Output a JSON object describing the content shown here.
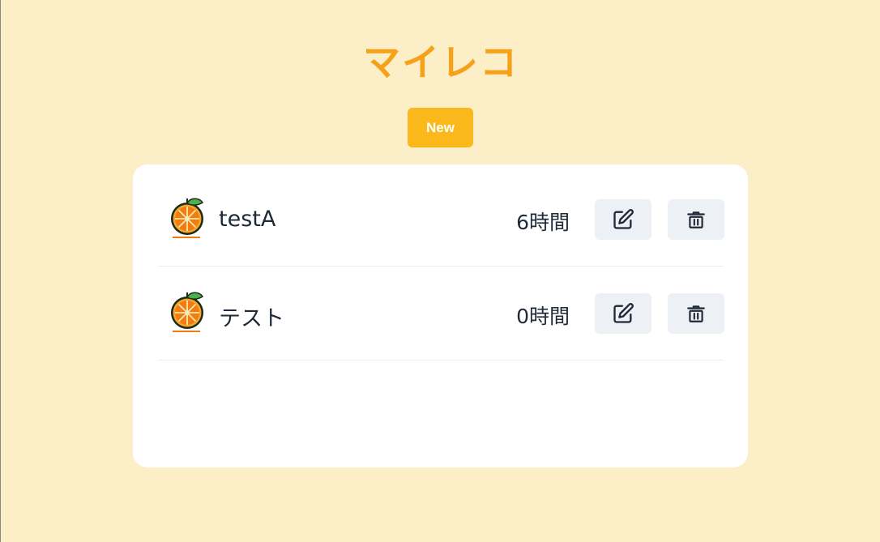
{
  "header": {
    "title": "マイレコ",
    "new_label": "New"
  },
  "records": [
    {
      "name": "testA",
      "hours": "6時間"
    },
    {
      "name": "テスト",
      "hours": "0時間"
    }
  ],
  "colors": {
    "background": "#fcefc7",
    "title": "#f5a21a",
    "new_button": "#fbb81b",
    "card": "#ffffff",
    "icon_button": "#edf1f6"
  },
  "icons": {
    "record": "orange-icon",
    "edit": "edit-icon",
    "delete": "trash-icon"
  }
}
